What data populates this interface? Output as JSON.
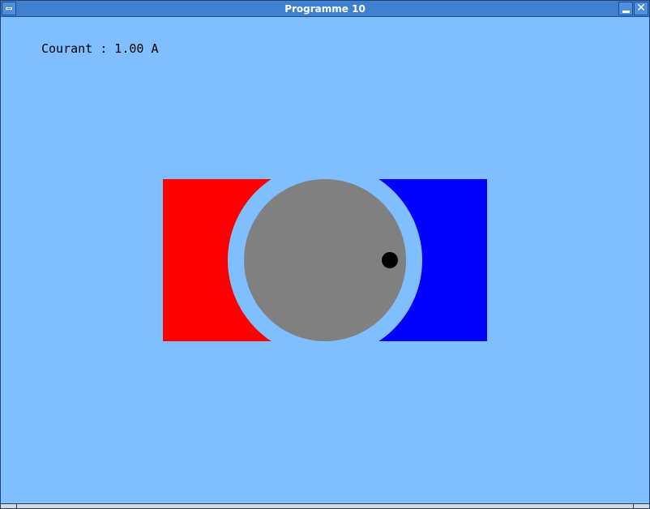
{
  "window": {
    "title": "Programme 10"
  },
  "display": {
    "current_text": "Courant : 1.00 A"
  },
  "icons": {
    "menu": "window-menu-icon",
    "minimize": "minimize-icon",
    "close": "close-icon"
  },
  "colors": {
    "background": "#80bfff",
    "north_pole": "#ff0000",
    "south_pole": "#0000ff",
    "rotor": "#808080",
    "rotor_marker": "#000000",
    "titlebar": "#3f7fcf"
  }
}
